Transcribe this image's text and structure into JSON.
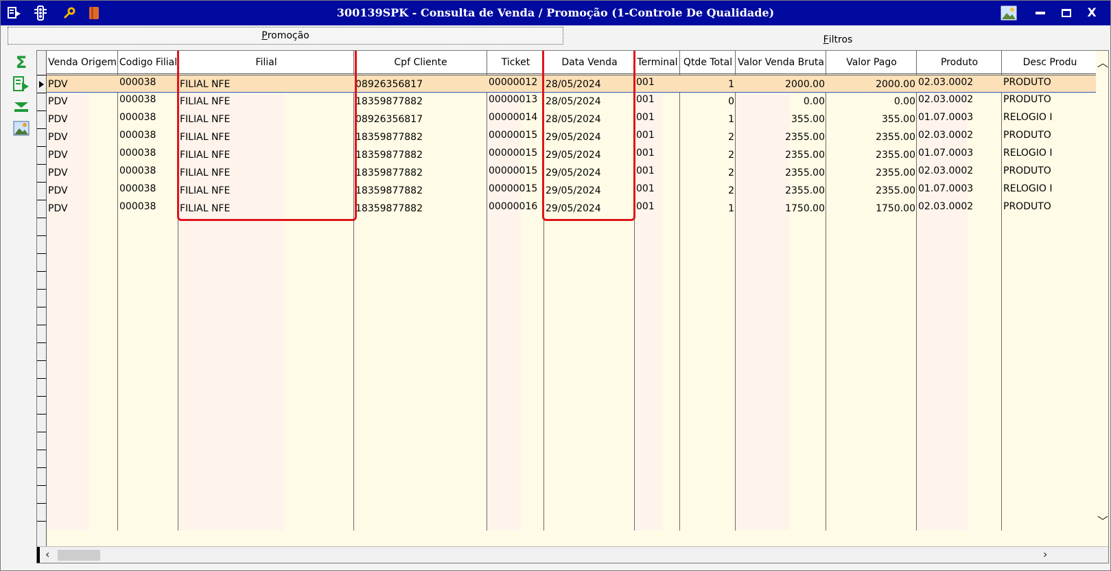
{
  "window": {
    "title": "300139SPK - Consulta de Venda / Promoção (1-Controle De Qualidade)",
    "toolbar_icons": [
      "menu-icon",
      "traffic-light-icon",
      "wrench-icon",
      "book-icon"
    ],
    "controls": {
      "image_icon": "image-icon",
      "minimize": "▬",
      "maximize": "☐",
      "close": "X"
    }
  },
  "tabs": {
    "promocao": {
      "prefix": "",
      "hotkey": "P",
      "rest": "romoção"
    },
    "filtros": {
      "hotkey": "F",
      "rest": "iltros"
    }
  },
  "side_toolbar": [
    "sum-icon",
    "export-icon",
    "collapse-icon",
    "image-icon"
  ],
  "grid": {
    "columns": [
      "Venda Origem",
      "Codigo Filial",
      "Filial",
      "Cpf Cliente",
      "Ticket",
      "Data Venda",
      "Terminal",
      "Qtde Total",
      "Valor Venda Bruta",
      "Valor Pago",
      "Produto",
      "Desc Produ"
    ],
    "rows": [
      [
        "PDV",
        "000038",
        "FILIAL NFE",
        "08926356817",
        "00000012",
        "28/05/2024",
        "001",
        "1",
        "2000.00",
        "2000.00",
        "02.03.0002",
        "PRODUTO"
      ],
      [
        "PDV",
        "000038",
        "FILIAL NFE",
        "18359877882",
        "00000013",
        "28/05/2024",
        "001",
        "0",
        "0.00",
        "0.00",
        "02.03.0002",
        "PRODUTO"
      ],
      [
        "PDV",
        "000038",
        "FILIAL NFE",
        "08926356817",
        "00000014",
        "28/05/2024",
        "001",
        "1",
        "355.00",
        "355.00",
        "01.07.0003",
        "RELOGIO I"
      ],
      [
        "PDV",
        "000038",
        "FILIAL NFE",
        "18359877882",
        "00000015",
        "29/05/2024",
        "001",
        "2",
        "2355.00",
        "2355.00",
        "02.03.0002",
        "PRODUTO"
      ],
      [
        "PDV",
        "000038",
        "FILIAL NFE",
        "18359877882",
        "00000015",
        "29/05/2024",
        "001",
        "2",
        "2355.00",
        "2355.00",
        "01.07.0003",
        "RELOGIO I"
      ],
      [
        "PDV",
        "000038",
        "FILIAL NFE",
        "18359877882",
        "00000015",
        "29/05/2024",
        "001",
        "2",
        "2355.00",
        "2355.00",
        "02.03.0002",
        "PRODUTO"
      ],
      [
        "PDV",
        "000038",
        "FILIAL NFE",
        "18359877882",
        "00000015",
        "29/05/2024",
        "001",
        "2",
        "2355.00",
        "2355.00",
        "01.07.0003",
        "RELOGIO I"
      ],
      [
        "PDV",
        "000038",
        "FILIAL NFE",
        "18359877882",
        "00000016",
        "29/05/2024",
        "001",
        "1",
        "1750.00",
        "1750.00",
        "02.03.0002",
        "PRODUTO"
      ]
    ],
    "selected_row": 0,
    "highlighted_columns": [
      "Filial",
      "Data Venda"
    ],
    "highlight_color": "#e0141b"
  }
}
